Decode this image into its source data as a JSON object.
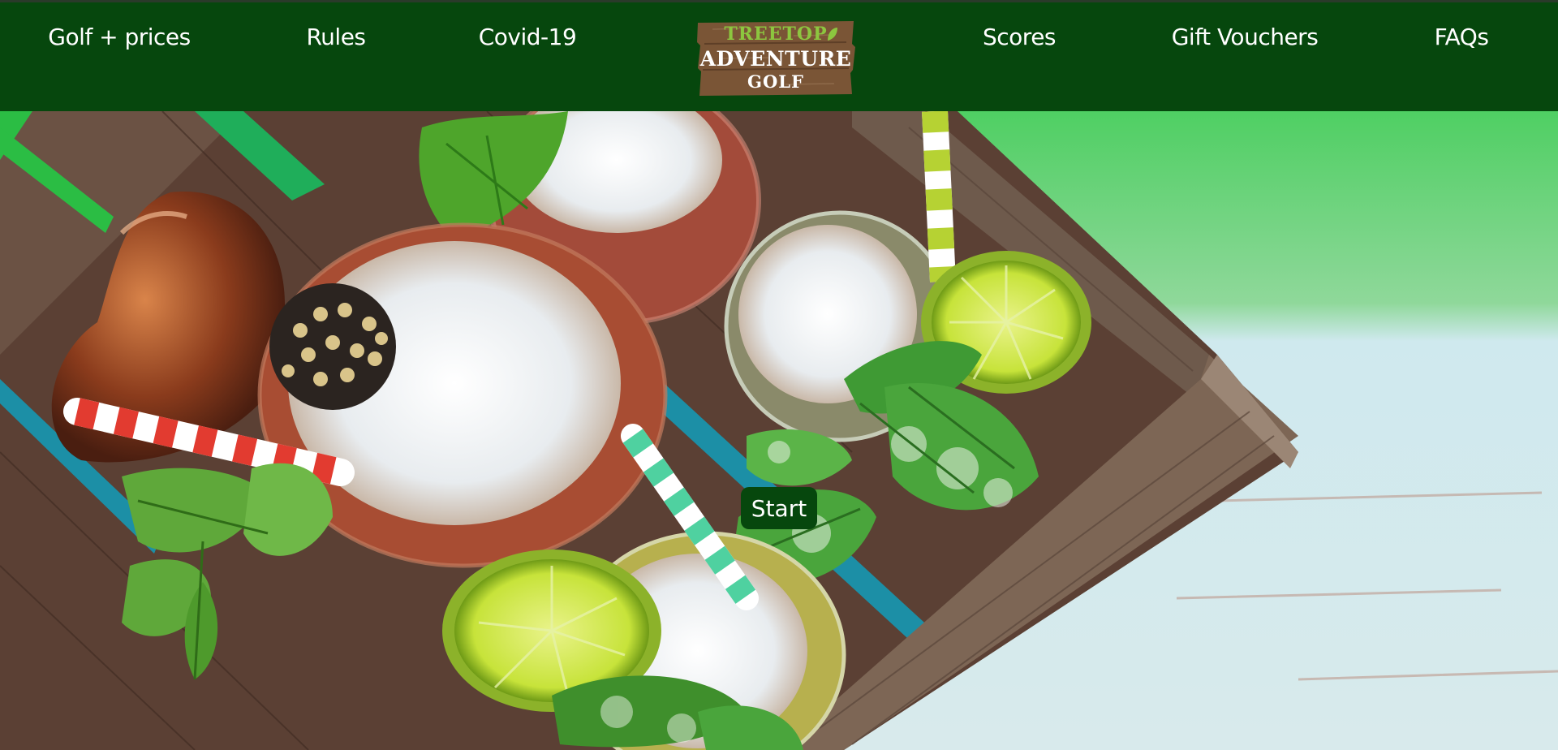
{
  "nav": {
    "items": [
      {
        "label": "Golf + prices"
      },
      {
        "label": "Rules"
      },
      {
        "label": "Covid-19"
      },
      {
        "label": "Scores"
      },
      {
        "label": "Gift Vouchers"
      },
      {
        "label": "FAQs"
      }
    ]
  },
  "logo": {
    "line1": "TREETOP",
    "line2": "ADVENTURE",
    "line3": "GOLF",
    "icon": "leaf-icon"
  },
  "hero": {
    "start_label": "Start",
    "image": "cocktails-in-wooden-crate-photo"
  },
  "colors": {
    "nav_bg": "#06470d",
    "logo_green": "#8cc63f",
    "logo_wood": "#7a5536",
    "button_bg": "#06470d"
  }
}
